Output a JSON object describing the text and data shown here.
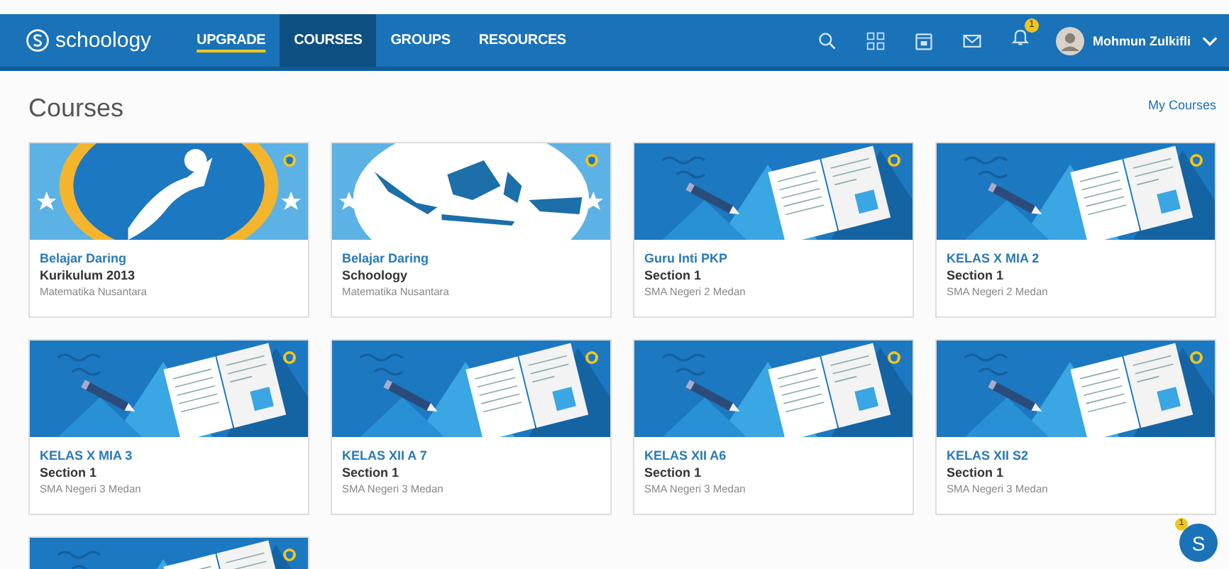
{
  "navbar": {
    "logo": "schoology",
    "items": [
      {
        "label": "UPGRADE",
        "kind": "upgrade",
        "selected": false
      },
      {
        "label": "COURSES",
        "kind": "link",
        "selected": true
      },
      {
        "label": "GROUPS",
        "kind": "link",
        "selected": false
      },
      {
        "label": "RESOURCES",
        "kind": "link",
        "selected": false
      }
    ],
    "notification_count": "1",
    "user_name": "Mohmun Zulkifli"
  },
  "page": {
    "title": "Courses",
    "my_courses_link": "My Courses"
  },
  "courses": [
    {
      "kind": "logo",
      "title": "Belajar Daring",
      "section": "Kurikulum 2013",
      "school": "Matematika Nusantara"
    },
    {
      "kind": "map",
      "title": "Belajar Daring",
      "section": "Schoology",
      "school": "Matematika Nusantara"
    },
    {
      "kind": "book",
      "title": "Guru Inti PKP",
      "section": "Section 1",
      "school": "SMA Negeri 2 Medan"
    },
    {
      "kind": "book",
      "title": "KELAS X MIA 2",
      "section": "Section 1",
      "school": "SMA Negeri 2 Medan"
    },
    {
      "kind": "book",
      "title": "KELAS X MIA 3",
      "section": "Section 1",
      "school": "SMA Negeri 3 Medan"
    },
    {
      "kind": "book",
      "title": "KELAS XII A 7",
      "section": "Section 1",
      "school": "SMA Negeri 3 Medan"
    },
    {
      "kind": "book",
      "title": "KELAS XII A6",
      "section": "Section 1",
      "school": "SMA Negeri 3 Medan"
    },
    {
      "kind": "book",
      "title": "KELAS XII S2",
      "section": "Section 1",
      "school": "SMA Negeri 3 Medan"
    },
    {
      "kind": "book"
    }
  ],
  "chat": {
    "label": "S",
    "badge": "1"
  }
}
